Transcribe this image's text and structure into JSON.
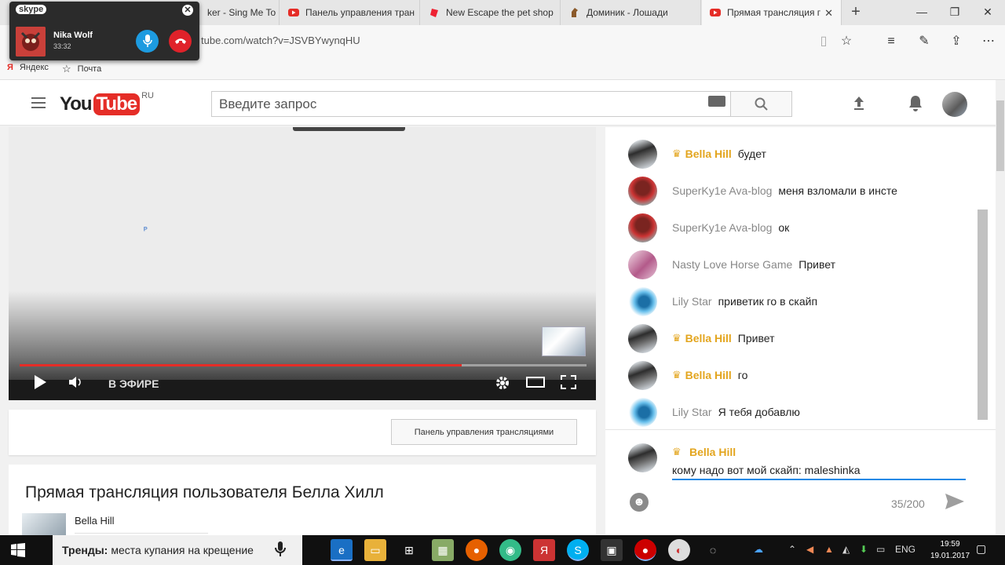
{
  "browser": {
    "tabs": [
      {
        "label": "ker - Sing Me To",
        "icon": "youtube-icon",
        "active": false
      },
      {
        "label": "Панель управления тран",
        "icon": "youtube-icon",
        "active": false
      },
      {
        "label": "New Escape the pet shop",
        "icon": "game-icon",
        "active": false
      },
      {
        "label": "Доминик - Лошади",
        "icon": "horse-icon",
        "active": false
      },
      {
        "label": "Прямая трансляция г",
        "icon": "youtube-icon",
        "active": true
      }
    ],
    "url": "tube.com/watch?v=JSVBYwynqHU",
    "favorites": [
      {
        "label": "Яндекс",
        "icon": "yandex-icon"
      },
      {
        "label": "Почта",
        "icon": "star-icon"
      }
    ]
  },
  "skype": {
    "logo": "skype",
    "caller": "Nika Wolf",
    "duration": "33:32"
  },
  "youtube": {
    "logo_you": "You",
    "logo_tube": "Tube",
    "logo_region": "RU",
    "search_placeholder": "Введите запрос"
  },
  "player": {
    "live_label": "В ЭФИРЕ",
    "progress_fraction": 0.78
  },
  "controls": {
    "panel_button": "Панель управления трансляциями"
  },
  "video_info": {
    "title": "Прямая трансляция пользователя Белла Хилл",
    "channel": "Bella Hill"
  },
  "chat": {
    "messages": [
      {
        "author": "Bella Hill",
        "text": "будет",
        "owner": true,
        "avatar": "bella"
      },
      {
        "author": "SuperKy1e Ava-blog",
        "text": "меня взломали в инсте",
        "owner": false,
        "avatar": "super"
      },
      {
        "author": "SuperKy1e Ava-blog",
        "text": "ок",
        "owner": false,
        "avatar": "super"
      },
      {
        "author": "Nasty Love Horse Game",
        "text": "Привет",
        "owner": false,
        "avatar": "nasty"
      },
      {
        "author": "Lily Star",
        "text": "приветик го в скайп",
        "owner": false,
        "avatar": "lily"
      },
      {
        "author": "Bella Hill",
        "text": "Привет",
        "owner": true,
        "avatar": "bella"
      },
      {
        "author": "Bella Hill",
        "text": "го",
        "owner": true,
        "avatar": "bella"
      },
      {
        "author": "Lily Star",
        "text": "Я тебя добавлю",
        "owner": false,
        "avatar": "lily"
      }
    ],
    "composer": {
      "author": "Bella Hill",
      "value": "кому надо вот мой скайп: maleshinka",
      "counter": "35/200"
    }
  },
  "taskbar": {
    "search_bold": "Тренды:",
    "search_text": "места купания на крещение",
    "lang": "ENG",
    "time": "19:59",
    "date": "19.01.2017"
  }
}
